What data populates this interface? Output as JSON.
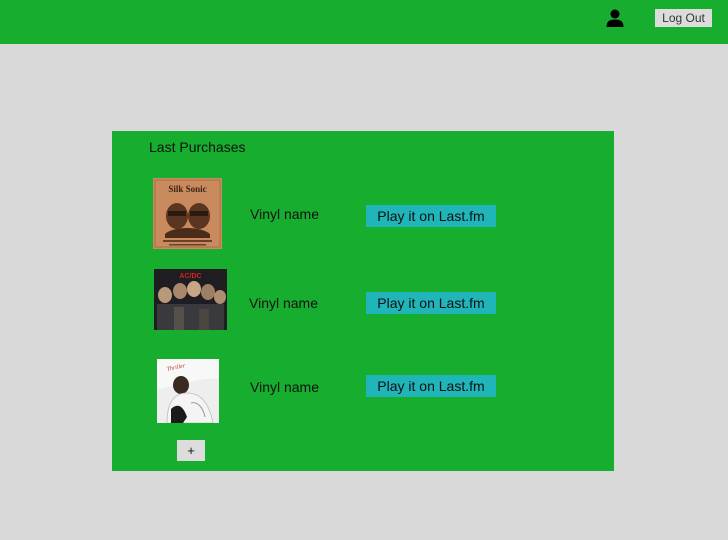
{
  "header": {
    "logout_label": "Log Out",
    "user_icon": "user-icon"
  },
  "purchases": {
    "title": "Last Purchases",
    "items": [
      {
        "cover_text": "Silk Sonic",
        "name": "Vinyl name",
        "play_label": "Play it on Last.fm"
      },
      {
        "cover_text": "AC/DC",
        "name": "Vinyl name",
        "play_label": "Play it on Last.fm"
      },
      {
        "cover_text": "",
        "name": "Vinyl name",
        "play_label": "Play it on Last.fm"
      }
    ],
    "add_label": "+"
  },
  "colors": {
    "header_bg": "#17ad2f",
    "panel_bg": "#17ad2f",
    "page_bg": "#d9d9d9",
    "play_button_bg": "#1fb5b9"
  }
}
